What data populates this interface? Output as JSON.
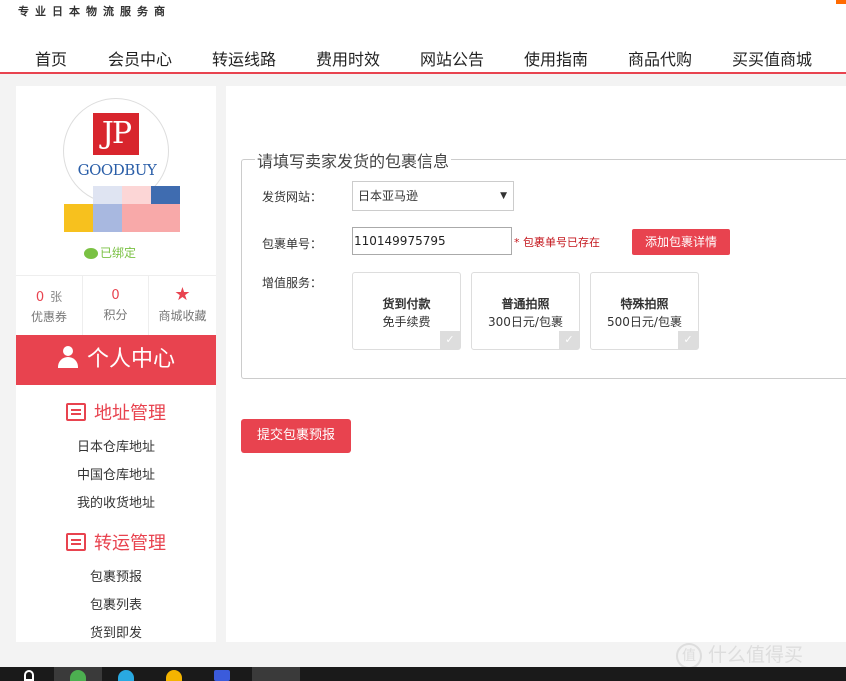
{
  "header": {
    "slogan": "专业日本物流服务商",
    "nav": [
      "首页",
      "会员中心",
      "转运线路",
      "费用时效",
      "网站公告",
      "使用指南",
      "商品代购",
      "买买值商城"
    ]
  },
  "profile": {
    "logo_jp": "JP",
    "logo_brand": "GOODBUY",
    "wechat_text": "已绑定"
  },
  "stats": {
    "coupons": {
      "value": "0",
      "unit": "张",
      "label": "优惠券"
    },
    "points": {
      "value": "0",
      "label": "积分"
    },
    "favorites": {
      "label": "商城收藏"
    }
  },
  "sidebar": {
    "personal_center": "个人中心",
    "address_section": {
      "title": "地址管理",
      "items": [
        "日本仓库地址",
        "中国仓库地址",
        "我的收货地址"
      ]
    },
    "transport_section": {
      "title": "转运管理",
      "items": [
        "包裹预报",
        "包裹列表",
        "货到即发"
      ]
    }
  },
  "form": {
    "legend": "请填写卖家发货的包裹信息",
    "site_label": "发货网站：",
    "site_value": "日本亚马逊",
    "tracking_label": "包裹单号：",
    "tracking_value": "110149975795",
    "tracking_error": "* 包裹单号已存在",
    "add_detail_label": "添加包裹详情",
    "services_label": "增值服务：",
    "services": [
      {
        "title": "货到付款",
        "sub": "免手续费"
      },
      {
        "title": "普通拍照",
        "sub": "300日元/包裹"
      },
      {
        "title": "特殊拍照",
        "sub": "500日元/包裹"
      }
    ],
    "submit_label": "提交包裹预报"
  },
  "watermark": {
    "badge": "值",
    "text": "什么值得买"
  },
  "colors": {
    "accent": "#e8434f",
    "error": "#c4161c",
    "brand_blue": "#2a5ea8"
  }
}
